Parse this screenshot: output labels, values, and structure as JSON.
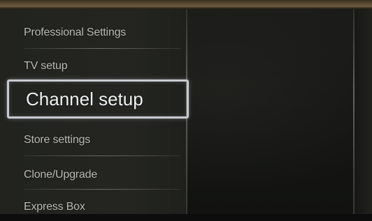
{
  "menu": {
    "items": [
      {
        "label": "Professional Settings"
      },
      {
        "label": "TV setup"
      },
      {
        "label": "Channel setup",
        "selected": true
      },
      {
        "label": "Store settings"
      },
      {
        "label": "Clone/Upgrade"
      },
      {
        "label": "Express Box"
      }
    ]
  },
  "colors": {
    "highlight_border": "#c9cbd2",
    "menu_text": "#b8bab3",
    "selected_text": "#eef0f2"
  }
}
